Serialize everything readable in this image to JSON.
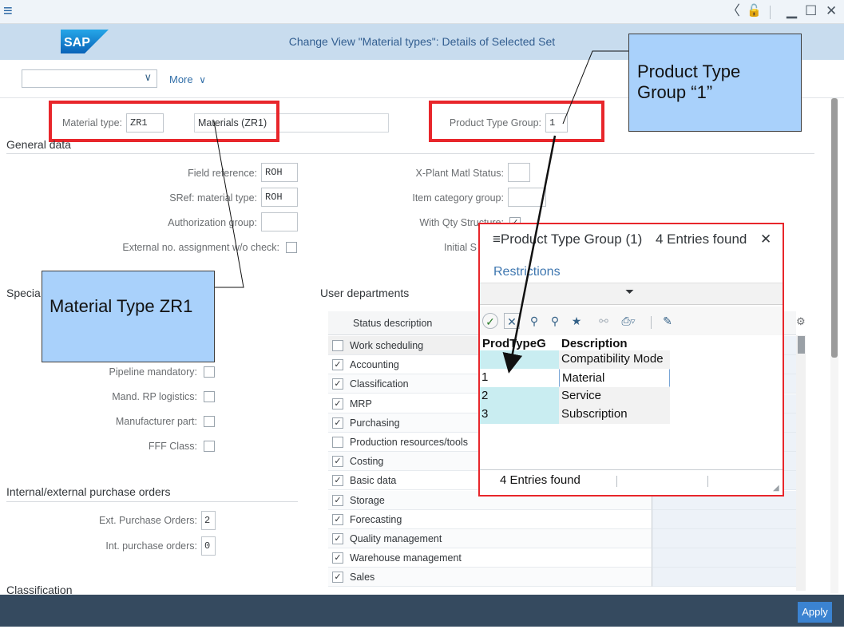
{
  "window": {
    "menu_glyph": "≡",
    "back_glyph": "〈",
    "lock_glyph": "🔓",
    "min_glyph": "▁",
    "max_glyph": "☐",
    "close_glyph": "✕"
  },
  "header": {
    "logo_text": "SAP",
    "title": "Change View \"Material types\": Details of Selected Set"
  },
  "toolbar": {
    "variant_value": "",
    "more_label": "More",
    "chevron": "∨"
  },
  "form": {
    "material_type_label": "Material type:",
    "material_type_value": "ZR1",
    "material_type_desc": "Materials (ZR1)",
    "product_type_group_label": "Product Type Group:",
    "product_type_group_value": "1"
  },
  "general_data": {
    "title": "General data",
    "field_reference_label": "Field reference:",
    "field_reference_value": "ROH",
    "sref_label": "SRef: material type:",
    "sref_value": "ROH",
    "auth_group_label": "Authorization group:",
    "auth_group_value": "",
    "ext_no_label": "External no. assignment w/o check:",
    "xplant_label": "X-Plant Matl Status:",
    "item_cat_label": "Item category group:",
    "qty_struct_label": "With Qty Structure:",
    "initial_label": "Initial S"
  },
  "special": {
    "title": "Specia",
    "pipeline_label": "Pipeline mandatory:",
    "rp_logistics_label": "Mand. RP logistics:",
    "manufacturer_label": "Manufacturer part:",
    "fff_label": "FFF Class:"
  },
  "purchase_orders": {
    "title": "Internal/external purchase orders",
    "ext_label": "Ext. Purchase Orders:",
    "ext_value": "2",
    "int_label": "Int. purchase orders:",
    "int_value": "0"
  },
  "classification": {
    "title": "Classification"
  },
  "user_departments": {
    "title": "User departments",
    "header": "Status description",
    "rows": [
      {
        "label": "Work scheduling",
        "checked": false
      },
      {
        "label": "Accounting",
        "checked": true
      },
      {
        "label": "Classification",
        "checked": true
      },
      {
        "label": "MRP",
        "checked": true
      },
      {
        "label": "Purchasing",
        "checked": true
      },
      {
        "label": "Production resources/tools",
        "checked": false
      },
      {
        "label": "Costing",
        "checked": true
      },
      {
        "label": "Basic data",
        "checked": true
      },
      {
        "label": "Storage",
        "checked": true
      },
      {
        "label": "Forecasting",
        "checked": true
      },
      {
        "label": "Quality management",
        "checked": true
      },
      {
        "label": "Warehouse management",
        "checked": true
      },
      {
        "label": "Sales",
        "checked": true
      }
    ]
  },
  "popup": {
    "menu_glyph": "≡",
    "title": "Product Type Group (1)",
    "entries": "4 Entries found",
    "close_glyph": "✕",
    "restrictions": "Restrictions",
    "col_code": "ProdTypeG",
    "col_desc": "Description",
    "rows": [
      {
        "code": "",
        "desc": "Compatibility Mode"
      },
      {
        "code": "1",
        "desc": "Material"
      },
      {
        "code": "2",
        "desc": "Service"
      },
      {
        "code": "3",
        "desc": "Subscription"
      }
    ],
    "footer_entries": "4 Entries found"
  },
  "callouts": {
    "product_type_group": "Product Type Group “1”",
    "material_type": "Material Type ZR1"
  },
  "footer": {
    "apply_label": "Apply"
  },
  "colors": {
    "highlight_red": "#e8262b",
    "callout_blue": "#a9d1fb",
    "header_blue": "#c8dcee",
    "footer_dark": "#354a5f",
    "apply_blue": "#3b83d1"
  }
}
